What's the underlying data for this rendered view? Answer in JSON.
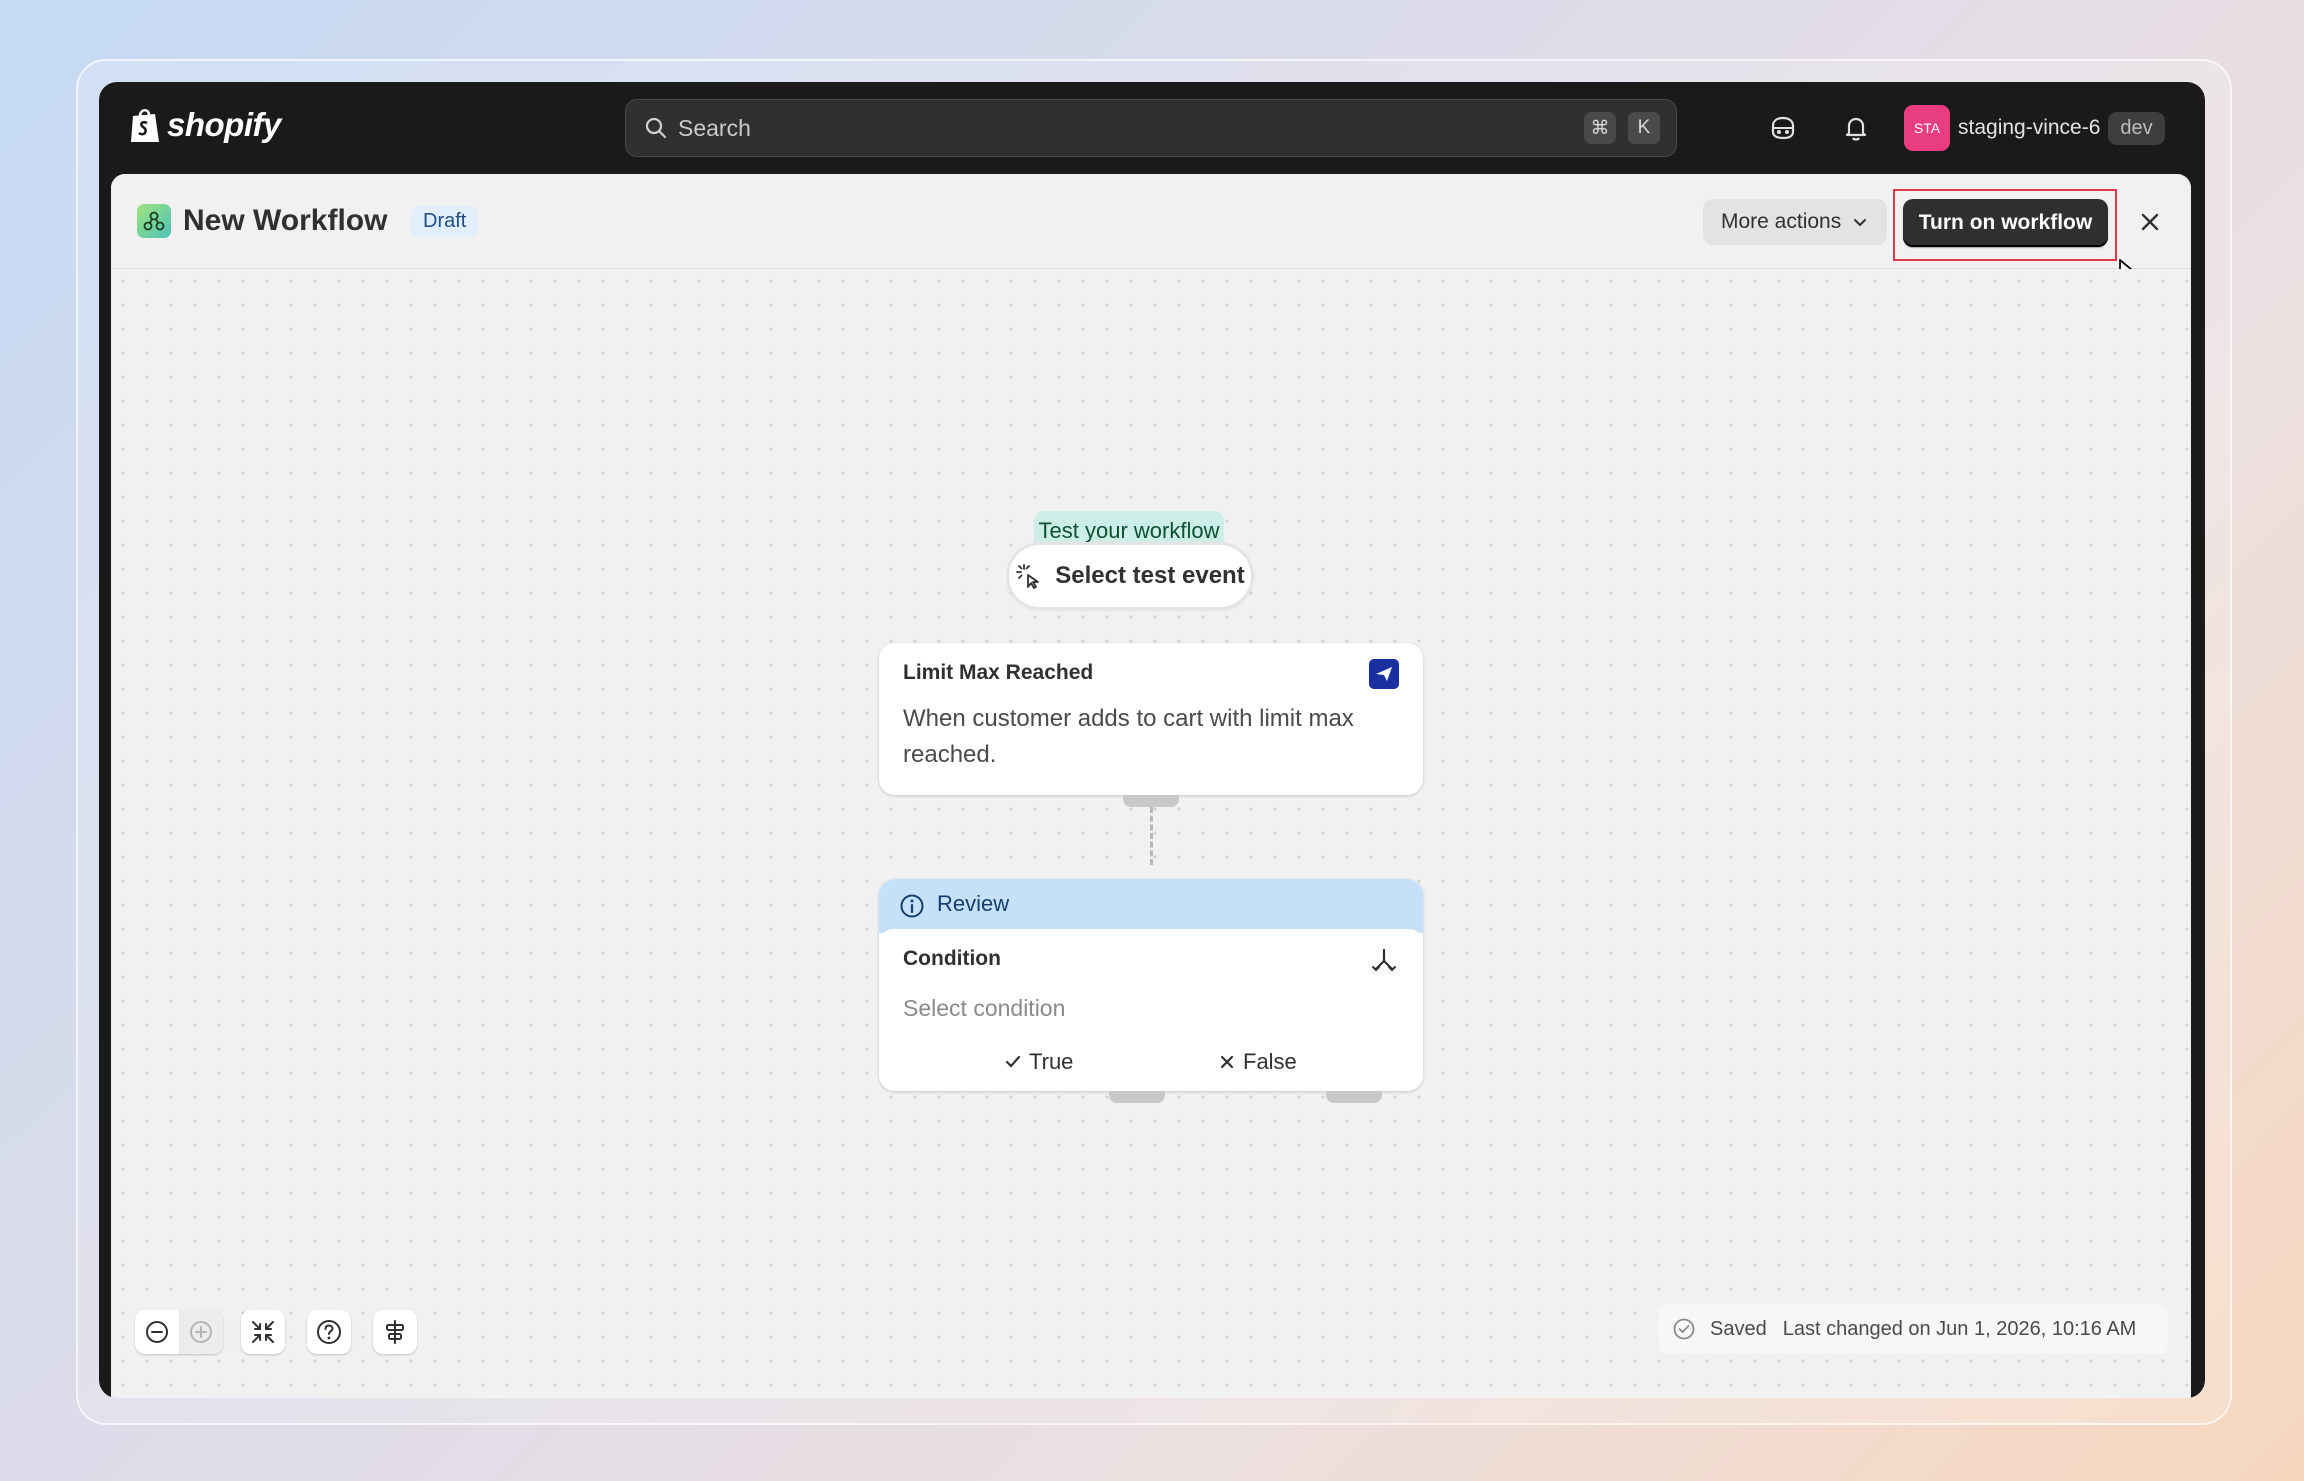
{
  "topbar": {
    "logo_text": "shopify",
    "search_placeholder": "Search",
    "shortcut_keys": [
      "⌘",
      "K"
    ],
    "store": {
      "avatar_text": "STA",
      "name": "staging-vince-6",
      "badge": "dev",
      "avatar_color": "#e93d82"
    }
  },
  "header": {
    "title": "New Workflow",
    "status_badge": "Draft",
    "more_actions_label": "More actions",
    "primary_button_label": "Turn on workflow"
  },
  "canvas": {
    "test_label": "Test your workflow",
    "test_button_label": "Select test event",
    "trigger": {
      "title": "Limit Max Reached",
      "description": "When customer adds to cart with limit max reached."
    },
    "condition": {
      "review_label": "Review",
      "title": "Condition",
      "placeholder": "Select condition",
      "true_label": "True",
      "false_label": "False"
    }
  },
  "footer": {
    "saved_label": "Saved",
    "last_changed": "Last changed on Jun 1, 2026, 10:16 AM"
  },
  "icons": [
    "search-icon",
    "bell-icon",
    "assistant-icon",
    "chevron-down-icon",
    "close-icon",
    "cursor-click-icon",
    "send-icon",
    "info-icon",
    "branch-icon",
    "check-icon",
    "x-icon",
    "zoom-out-icon",
    "zoom-in-icon",
    "fit-view-icon",
    "help-icon",
    "align-icon",
    "check-circle-icon"
  ],
  "colors": {
    "accent_red": "#e0384f",
    "primary_dark": "#303030",
    "review_blue": "#c7e0fa",
    "test_green": "#cdeee6"
  }
}
